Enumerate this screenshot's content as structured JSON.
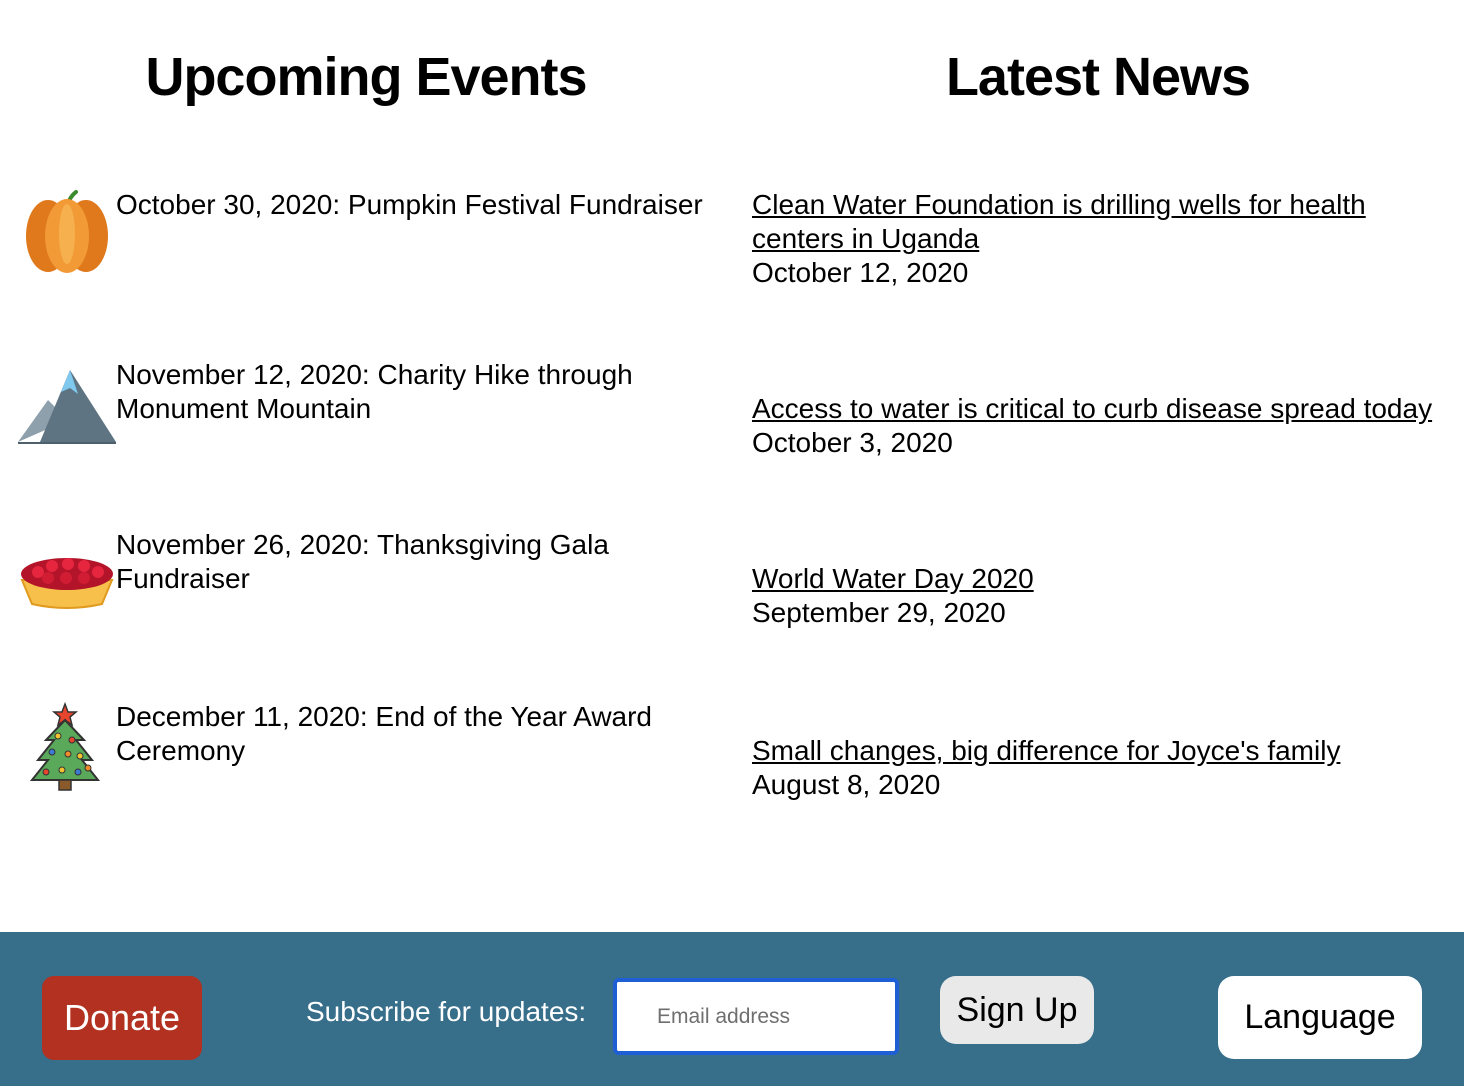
{
  "events": {
    "heading": "Upcoming Events",
    "items": [
      {
        "icon": "pumpkin-icon",
        "text": "October 30, 2020: Pumpkin Festival Fundraiser"
      },
      {
        "icon": "mountain-icon",
        "text": "November 12, 2020: Charity Hike through Monument Mountain"
      },
      {
        "icon": "pie-icon",
        "text": "November 26, 2020: Thanksgiving Gala Fundraiser"
      },
      {
        "icon": "christmas-tree-icon",
        "text": "December 11, 2020: End of the Year Award Ceremony"
      }
    ]
  },
  "news": {
    "heading": "Latest News",
    "items": [
      {
        "title": "Clean Water Foundation is drilling wells for health centers in Uganda",
        "date": "October 12, 2020"
      },
      {
        "title": "Access to water is critical to curb disease spread today",
        "date": "October 3, 2020"
      },
      {
        "title": "World Water Day 2020",
        "date": "September 29, 2020"
      },
      {
        "title": "Small changes, big difference for Joyce's family",
        "date": "August 8, 2020"
      }
    ]
  },
  "footer": {
    "donate_label": "Donate",
    "subscribe_label": "Subscribe for updates:",
    "email_placeholder": "Email address",
    "email_value": "",
    "signup_label": "Sign Up",
    "language_label": "Language",
    "background_color": "#376e8a",
    "donate_color": "#b33120"
  }
}
